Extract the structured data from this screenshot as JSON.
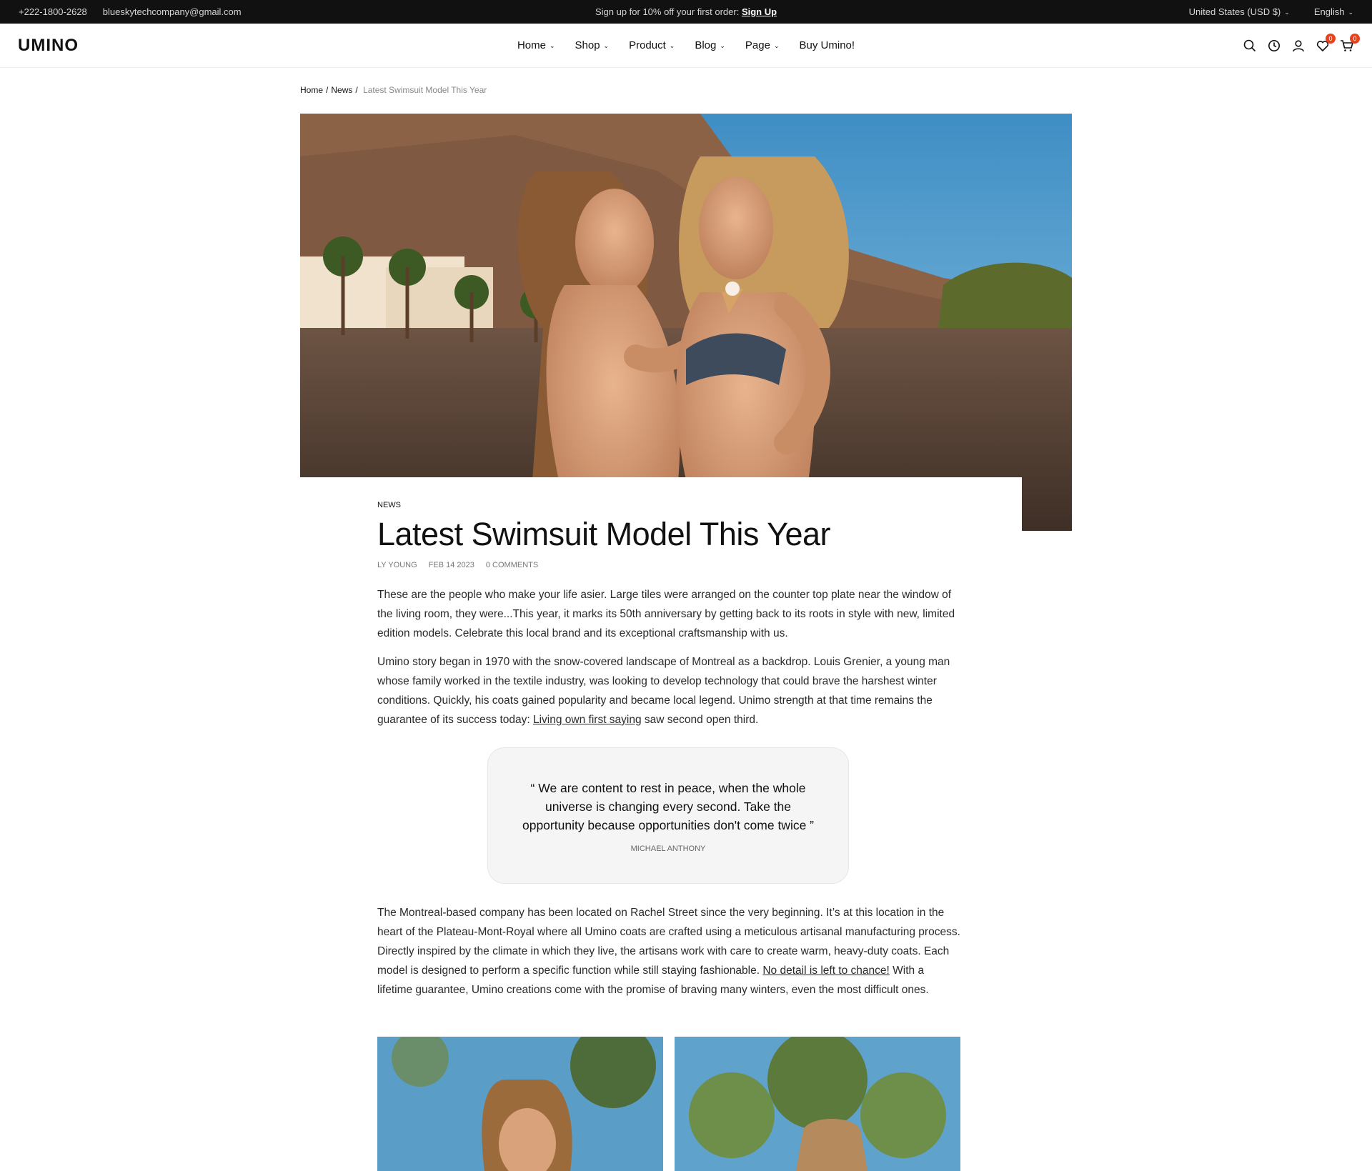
{
  "topbar": {
    "phone": "+222-1800-2628",
    "email": "blueskytechcompany@gmail.com",
    "promo_text": "Sign up for 10% off your first order: ",
    "promo_link": "Sign Up",
    "currency": "United States (USD $)",
    "language": "English"
  },
  "header": {
    "logo": "UMINO",
    "nav": [
      "Home",
      "Shop",
      "Product",
      "Blog",
      "Page",
      "Buy Umino!"
    ],
    "wishlist_count": "0",
    "cart_count": "0"
  },
  "breadcrumb": {
    "items": [
      "Home",
      "News"
    ],
    "current": "Latest Swimsuit Model This Year"
  },
  "article": {
    "category": "NEWS",
    "title": "Latest Swimsuit Model This Year",
    "author": "LY YOUNG",
    "date": "FEB 14 2023",
    "comments": "0 COMMENTS",
    "paragraph1": "These are the people who make your life asier. Large tiles were arranged on the counter top plate near the window of the living room, they were...This year, it marks its 50th anniversary by getting back to its roots in style with new, limited edition models. Celebrate this local brand and its exceptional craftsmanship with us.",
    "paragraph2_before": "Umino story began in 1970 with the snow-covered landscape of Montreal as a backdrop. Louis Grenier, a young man whose family worked in the textile industry, was looking to develop technology that could brave the harshest winter conditions. Quickly, his coats gained popularity and became local legend. Unimo strength at that time remains the guarantee of its success today: ",
    "paragraph2_link": "Living own first saying",
    "paragraph2_after": " saw second open third.",
    "quote": "“ We are content to rest in peace, when the whole universe is changing every second. Take the opportunity because opportunities don't come twice ”",
    "quote_author": "MICHAEL ANTHONY",
    "paragraph3_before": "The Montreal-based company has been located on Rachel Street since the very beginning. It’s at this location in the heart of the Plateau-Mont-Royal where all Umino coats are crafted using a meticulous artisanal manufacturing process. Directly inspired by the climate in which they live, the artisans work with care to create warm, heavy-duty coats. Each model is designed to perform a specific function while still staying fashionable. ",
    "paragraph3_link": "No detail is left to chance!",
    "paragraph3_after": " With a lifetime guarantee, Umino creations come with the promise of braving many winters, even the most difficult ones."
  }
}
